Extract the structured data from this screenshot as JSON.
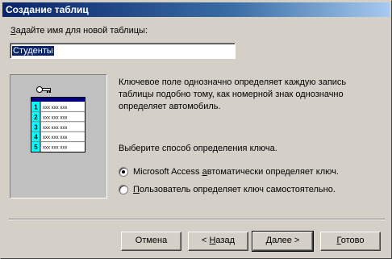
{
  "window": {
    "title": "Создание таблиц"
  },
  "name_prompt": {
    "pre": "",
    "hotkey": "З",
    "post": "адайте имя для новой таблицы:"
  },
  "table_name": "Студенты",
  "illustration": {
    "row_numbers": [
      "1",
      "2",
      "3",
      "4",
      "5"
    ],
    "cell_text": "xxx xxx xxx"
  },
  "description": "Ключевое поле однозначно определяет каждую запись таблицы подобно тому, как номерной знак однозначно определяет автомобиль.",
  "key_prompt": "Выберите способ определения ключа.",
  "options": [
    {
      "pre": "Microsoft Access ",
      "hotkey": "а",
      "post": "втоматически определяет ключ.",
      "selected": true
    },
    {
      "pre": "",
      "hotkey": "П",
      "post": "ользователь определяет ключ самостоятельно.",
      "selected": false
    }
  ],
  "buttons": {
    "cancel": {
      "pre": "Отмена",
      "hotkey": "",
      "post": ""
    },
    "back": {
      "pre": "< ",
      "hotkey": "Н",
      "post": "азад"
    },
    "next": {
      "pre": "",
      "hotkey": "Д",
      "post": "алее >"
    },
    "finish": {
      "pre": "",
      "hotkey": "Г",
      "post": "отово"
    }
  },
  "colors": {
    "title_start": "#0a246a",
    "title_end": "#a6caf0",
    "key_column": "#00ffff",
    "table_header": "#000080"
  }
}
